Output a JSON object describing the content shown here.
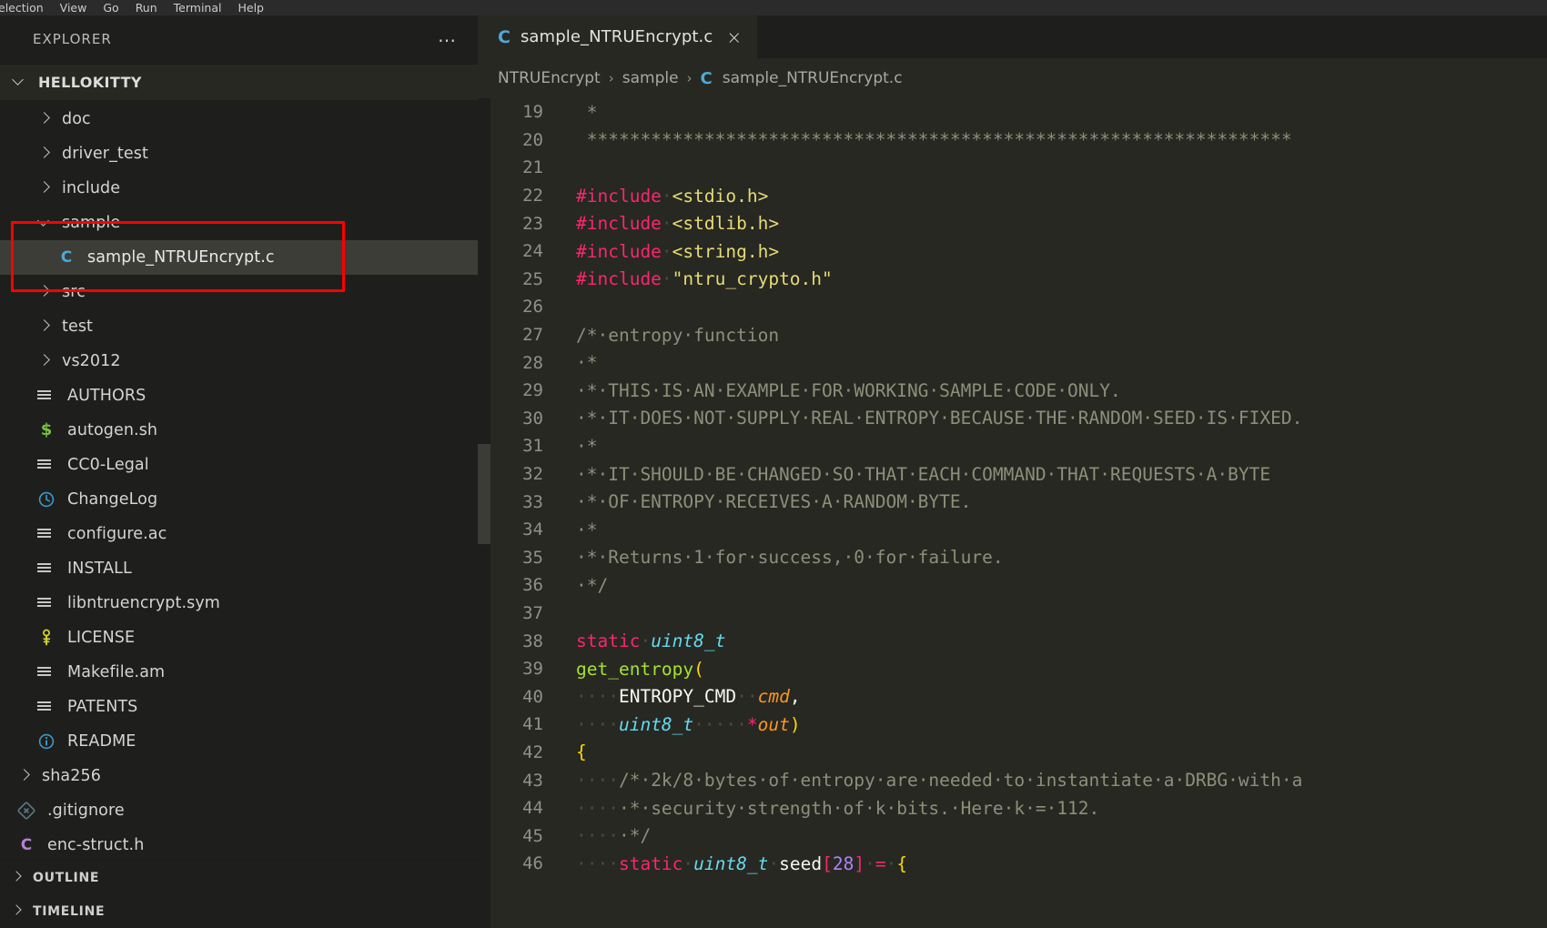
{
  "menubar": {
    "items": [
      "election",
      "View",
      "Go",
      "Run",
      "Terminal",
      "Help"
    ]
  },
  "sidebar": {
    "title": "EXPLORER",
    "more_actions": "…",
    "root_folder": "HELLOKITTY",
    "tree": [
      {
        "label": "doc",
        "type": "folder",
        "state": "collapsed",
        "depth": 1
      },
      {
        "label": "driver_test",
        "type": "folder",
        "state": "collapsed",
        "depth": 1
      },
      {
        "label": "include",
        "type": "folder",
        "state": "collapsed",
        "depth": 1
      },
      {
        "label": "sample",
        "type": "folder",
        "state": "expanded",
        "depth": 1,
        "highlighted": true
      },
      {
        "label": "sample_NTRUEncrypt.c",
        "type": "c-source",
        "icon": "c-blue",
        "depth": 2,
        "selected": true,
        "highlighted": true
      },
      {
        "label": "src",
        "type": "folder",
        "state": "collapsed",
        "depth": 1
      },
      {
        "label": "test",
        "type": "folder",
        "state": "collapsed",
        "depth": 1
      },
      {
        "label": "vs2012",
        "type": "folder",
        "state": "collapsed",
        "depth": 1
      },
      {
        "label": "AUTHORS",
        "type": "file",
        "icon": "text-lines-icon",
        "depth": 1
      },
      {
        "label": "autogen.sh",
        "type": "file",
        "icon": "shell-dollar-icon",
        "depth": 1
      },
      {
        "label": "CC0-Legal",
        "type": "file",
        "icon": "text-lines-icon",
        "depth": 1
      },
      {
        "label": "ChangeLog",
        "type": "file",
        "icon": "clock-icon",
        "depth": 1
      },
      {
        "label": "configure.ac",
        "type": "file",
        "icon": "text-lines-icon",
        "depth": 1
      },
      {
        "label": "INSTALL",
        "type": "file",
        "icon": "text-lines-icon",
        "depth": 1
      },
      {
        "label": "libntruencrypt.sym",
        "type": "file",
        "icon": "text-lines-icon",
        "depth": 1
      },
      {
        "label": "LICENSE",
        "type": "file",
        "icon": "key-icon",
        "depth": 1
      },
      {
        "label": "Makefile.am",
        "type": "file",
        "icon": "text-lines-icon",
        "depth": 1
      },
      {
        "label": "PATENTS",
        "type": "file",
        "icon": "text-lines-icon",
        "depth": 1
      },
      {
        "label": "README",
        "type": "file",
        "icon": "info-icon",
        "depth": 1
      },
      {
        "label": "sha256",
        "type": "folder",
        "state": "collapsed",
        "depth": 0
      },
      {
        "label": ".gitignore",
        "type": "file",
        "icon": "git-icon",
        "depth": 0
      },
      {
        "label": "enc-struct.h",
        "type": "c-header",
        "icon": "c-purple",
        "depth": 0
      }
    ],
    "bottom_panels": [
      {
        "label": "OUTLINE",
        "state": "collapsed"
      },
      {
        "label": "TIMELINE",
        "state": "collapsed"
      }
    ]
  },
  "editor": {
    "tab": {
      "icon": "c-file-icon",
      "label": "sample_NTRUEncrypt.c",
      "close": "×"
    },
    "breadcrumb": {
      "parts": [
        "NTRUEncrypt",
        "sample",
        "sample_NTRUEncrypt.c"
      ],
      "separator": "›",
      "file_icon": "C"
    },
    "first_line_number": 19,
    "lines": [
      {
        "n": 19,
        "tokens": [
          {
            "t": " *",
            "c": "c-comment",
            "indentGuide": false,
            "lead": "."
          }
        ]
      },
      {
        "n": 20,
        "tokens": [
          {
            "t": " ******************************************************************",
            "c": "c-comment"
          }
        ]
      },
      {
        "n": 21,
        "tokens": [
          {
            "t": " ",
            "c": "c-comment"
          }
        ]
      },
      {
        "n": 22,
        "tokens": [
          {
            "t": "#include",
            "c": "c-keyword"
          },
          {
            "t": "·",
            "c": "ws"
          },
          {
            "t": "<stdio.h>",
            "c": "c-string"
          }
        ]
      },
      {
        "n": 23,
        "tokens": [
          {
            "t": "#include",
            "c": "c-keyword"
          },
          {
            "t": "·",
            "c": "ws"
          },
          {
            "t": "<stdlib.h>",
            "c": "c-string"
          }
        ]
      },
      {
        "n": 24,
        "tokens": [
          {
            "t": "#include",
            "c": "c-keyword"
          },
          {
            "t": "·",
            "c": "ws"
          },
          {
            "t": "<string.h>",
            "c": "c-string"
          }
        ]
      },
      {
        "n": 25,
        "tokens": [
          {
            "t": "#include",
            "c": "c-keyword"
          },
          {
            "t": "·",
            "c": "ws"
          },
          {
            "t": "\"ntru_crypto.h\"",
            "c": "c-string"
          }
        ]
      },
      {
        "n": 26,
        "tokens": []
      },
      {
        "n": 27,
        "tokens": [
          {
            "t": "/*·entropy·function",
            "c": "c-comment"
          }
        ]
      },
      {
        "n": 28,
        "tokens": [
          {
            "t": "·*",
            "c": "c-comment"
          }
        ]
      },
      {
        "n": 29,
        "tokens": [
          {
            "t": "·*·THIS·IS·AN·EXAMPLE·FOR·WORKING·SAMPLE·CODE·ONLY.",
            "c": "c-comment"
          }
        ]
      },
      {
        "n": 30,
        "tokens": [
          {
            "t": "·*·IT·DOES·NOT·SUPPLY·REAL·ENTROPY·BECAUSE·THE·RANDOM·SEED·IS·FIXED.",
            "c": "c-comment"
          }
        ]
      },
      {
        "n": 31,
        "tokens": [
          {
            "t": "·*",
            "c": "c-comment"
          }
        ]
      },
      {
        "n": 32,
        "tokens": [
          {
            "t": "·*·IT·SHOULD·BE·CHANGED·SO·THAT·EACH·COMMAND·THAT·REQUESTS·A·BYTE",
            "c": "c-comment"
          }
        ]
      },
      {
        "n": 33,
        "tokens": [
          {
            "t": "·*·OF·ENTROPY·RECEIVES·A·RANDOM·BYTE.",
            "c": "c-comment"
          }
        ]
      },
      {
        "n": 34,
        "tokens": [
          {
            "t": "·*",
            "c": "c-comment"
          }
        ]
      },
      {
        "n": 35,
        "tokens": [
          {
            "t": "·*·Returns·1·for·success,·0·for·failure.",
            "c": "c-comment"
          }
        ]
      },
      {
        "n": 36,
        "tokens": [
          {
            "t": "·*/",
            "c": "c-comment"
          }
        ]
      },
      {
        "n": 37,
        "tokens": []
      },
      {
        "n": 38,
        "tokens": [
          {
            "t": "static",
            "c": "c-keyword"
          },
          {
            "t": "·",
            "c": "ws"
          },
          {
            "t": "uint8_t",
            "c": "c-type"
          }
        ]
      },
      {
        "n": 39,
        "tokens": [
          {
            "t": "get_entropy",
            "c": "c-func"
          },
          {
            "t": "(",
            "c": "c-bracket1"
          }
        ]
      },
      {
        "n": 40,
        "tokens": [
          {
            "t": "····",
            "c": "ws"
          },
          {
            "t": "ENTROPY_CMD",
            "c": "c-plain"
          },
          {
            "t": "··",
            "c": "ws"
          },
          {
            "t": "cmd",
            "c": "c-param"
          },
          {
            "t": ",",
            "c": "c-plain"
          }
        ]
      },
      {
        "n": 41,
        "tokens": [
          {
            "t": "····",
            "c": "ws"
          },
          {
            "t": "uint8_t",
            "c": "c-type"
          },
          {
            "t": "·····",
            "c": "ws"
          },
          {
            "t": "*",
            "c": "c-keyword"
          },
          {
            "t": "out",
            "c": "c-param"
          },
          {
            "t": ")",
            "c": "c-bracket1"
          }
        ]
      },
      {
        "n": 42,
        "tokens": [
          {
            "t": "{",
            "c": "c-bracket1"
          }
        ]
      },
      {
        "n": 43,
        "tokens": [
          {
            "t": "····",
            "c": "ws"
          },
          {
            "t": "/*·2k/8·bytes·of·entropy·are·needed·to·instantiate·a·DRBG·with·a",
            "c": "c-comment"
          }
        ]
      },
      {
        "n": 44,
        "tokens": [
          {
            "t": "····",
            "c": "ws"
          },
          {
            "t": "·*·security·strength·of·k·bits.·Here·k·=·112.",
            "c": "c-comment"
          }
        ]
      },
      {
        "n": 45,
        "tokens": [
          {
            "t": "····",
            "c": "ws"
          },
          {
            "t": "·*/",
            "c": "c-comment"
          }
        ]
      },
      {
        "n": 46,
        "tokens": [
          {
            "t": "····",
            "c": "ws"
          },
          {
            "t": "static",
            "c": "c-keyword"
          },
          {
            "t": "·",
            "c": "ws"
          },
          {
            "t": "uint8_t",
            "c": "c-type"
          },
          {
            "t": "·",
            "c": "ws"
          },
          {
            "t": "seed",
            "c": "c-plain"
          },
          {
            "t": "[",
            "c": "c-bracket2"
          },
          {
            "t": "28",
            "c": "c-num"
          },
          {
            "t": "]",
            "c": "c-bracket2"
          },
          {
            "t": "·",
            "c": "ws"
          },
          {
            "t": "=",
            "c": "c-keyword"
          },
          {
            "t": "·",
            "c": "ws"
          },
          {
            "t": "{",
            "c": "c-bracket1"
          }
        ]
      }
    ]
  },
  "colors": {
    "background": "#1e1f1c",
    "editor_background": "#272822",
    "selection": "#3c3d37",
    "annotation": "#ff0000",
    "keyword": "#f92672",
    "string": "#e6db74",
    "type": "#66d9ef",
    "function": "#a6e22e",
    "comment": "#8d8f7a",
    "param": "#fd971f",
    "number": "#ae81ff",
    "bracket": "#ffd700"
  }
}
